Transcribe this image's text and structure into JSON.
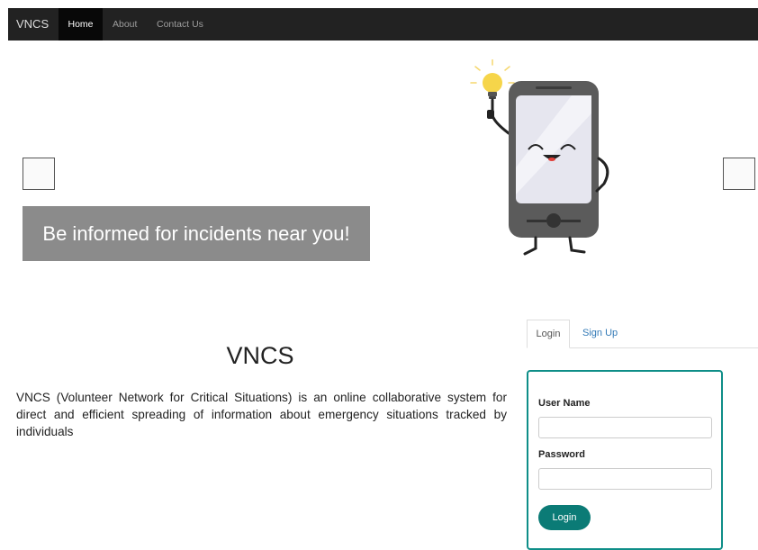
{
  "navbar": {
    "brand": "VNCS",
    "items": [
      {
        "label": "Home",
        "active": true
      },
      {
        "label": "About",
        "active": false
      },
      {
        "label": "Contact Us",
        "active": false
      }
    ]
  },
  "carousel": {
    "caption": "Be informed for incidents near you!",
    "illustration": "smiling-phone-with-lightbulb"
  },
  "main": {
    "heading": "VNCS",
    "description": "VNCS (Volunteer Network for Critical Situations) is an online collaborative system for direct and efficient spreading of information about emergency situations tracked by individuals"
  },
  "auth": {
    "tabs": [
      {
        "label": "Login",
        "active": true
      },
      {
        "label": "Sign Up",
        "active": false
      }
    ],
    "username_label": "User Name",
    "username_value": "",
    "password_label": "Password",
    "password_value": "",
    "submit_label": "Login"
  },
  "colors": {
    "navbar_bg": "#222222",
    "accent": "#0b7b76",
    "panel_border": "#0e8e88",
    "link": "#337ab7"
  }
}
